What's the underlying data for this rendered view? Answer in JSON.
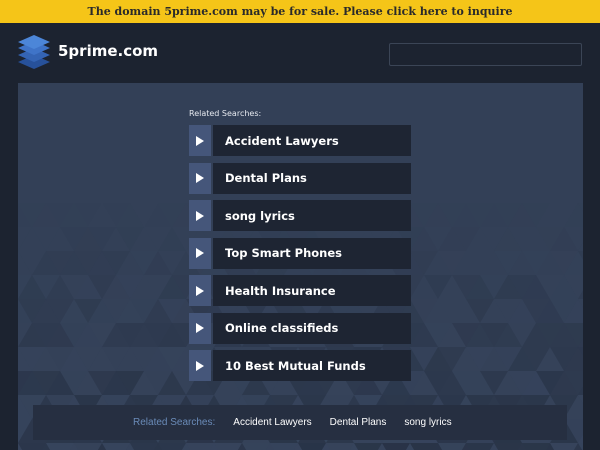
{
  "banner": {
    "text": "The domain 5prime.com may be for sale. Please click here to inquire",
    "color": "#f5c518"
  },
  "header": {
    "site_name": "5prime.com",
    "logo_icon": "stacked-layers-icon",
    "search_placeholder": ""
  },
  "related": {
    "title": "Related Searches:",
    "items": [
      {
        "label": "Accident Lawyers"
      },
      {
        "label": "Dental Plans"
      },
      {
        "label": "song lyrics"
      },
      {
        "label": "Top Smart Phones"
      },
      {
        "label": "Health Insurance"
      },
      {
        "label": "Online classifieds"
      },
      {
        "label": "10 Best Mutual Funds"
      }
    ]
  },
  "footer": {
    "label": "Related Searches:",
    "links": [
      {
        "label": "Accident Lawyers"
      },
      {
        "label": "Dental Plans"
      },
      {
        "label": "song lyrics"
      }
    ]
  },
  "colors": {
    "page_bg": "#1c2330",
    "panel_bg": "#334057",
    "arrow_box": "#45567a",
    "label_box": "#1e2533",
    "footer_label": "#6a8bb8"
  }
}
